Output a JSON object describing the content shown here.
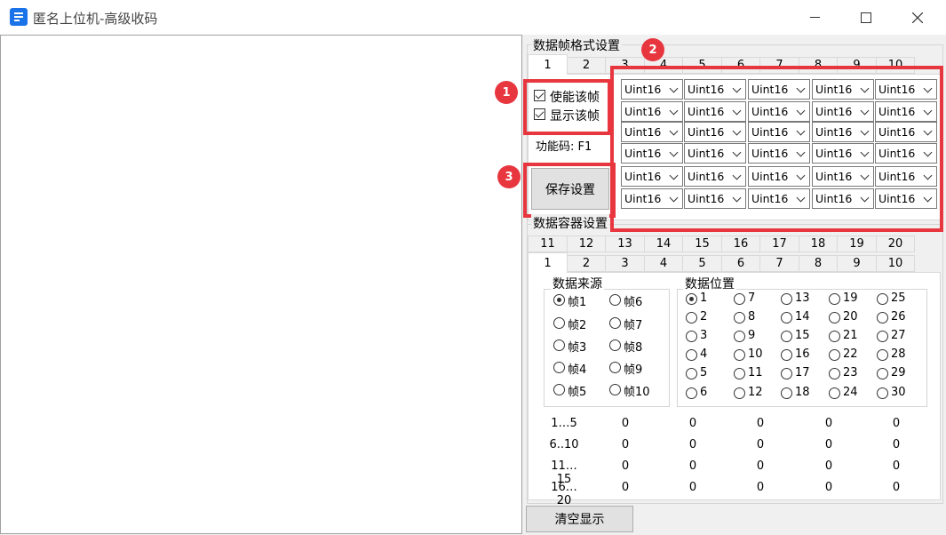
{
  "window": {
    "title": "匿名上位机-高级收码",
    "controls": [
      "minimize-icon",
      "maximize-icon",
      "close-icon"
    ]
  },
  "frame_format": {
    "group_title": "数据帧格式设置",
    "tabs": [
      "1",
      "2",
      "3",
      "4",
      "5",
      "6",
      "7",
      "8",
      "9",
      "10"
    ],
    "active_tab": "1",
    "enable_label": "使能该帧",
    "show_label": "显示该帧",
    "function_code_label": "功能码: F1",
    "save_button": "保存设置",
    "type_options_selected": [
      [
        "Uint16",
        "Uint16",
        "Uint16",
        "Uint16",
        "Uint16"
      ],
      [
        "Uint16",
        "Uint16",
        "Uint16",
        "Uint16",
        "Uint16"
      ],
      [
        "Uint16",
        "Uint16",
        "Uint16",
        "Uint16",
        "Uint16"
      ],
      [
        "Uint16",
        "Uint16",
        "Uint16",
        "Uint16",
        "Uint16"
      ],
      [
        "Uint16",
        "Uint16",
        "Uint16",
        "Uint16",
        "Uint16"
      ],
      [
        "Uint16",
        "Uint16",
        "Uint16",
        "Uint16",
        "Uint16"
      ]
    ]
  },
  "container": {
    "group_title": "数据容器设置",
    "tabs_row1": [
      "11",
      "12",
      "13",
      "14",
      "15",
      "16",
      "17",
      "18",
      "19",
      "20"
    ],
    "tabs_row2": [
      "1",
      "2",
      "3",
      "4",
      "5",
      "6",
      "7",
      "8",
      "9",
      "10"
    ],
    "active_tab": "1",
    "source_title": "数据来源",
    "sources": [
      "帧1",
      "帧2",
      "帧3",
      "帧4",
      "帧5",
      "帧6",
      "帧7",
      "帧8",
      "帧9",
      "帧10"
    ],
    "source_selected": "帧1",
    "position_title": "数据位置",
    "positions": [
      "1",
      "2",
      "3",
      "4",
      "5",
      "6",
      "7",
      "8",
      "9",
      "10",
      "11",
      "12",
      "13",
      "14",
      "15",
      "16",
      "17",
      "18",
      "19",
      "20",
      "21",
      "22",
      "23",
      "24",
      "25",
      "26",
      "27",
      "28",
      "29",
      "30"
    ],
    "position_selected": "1"
  },
  "values_table": {
    "row_labels": [
      "1…5",
      "6..10",
      "11…15",
      "16…20"
    ],
    "rows": [
      [
        "0",
        "0",
        "0",
        "0",
        "0"
      ],
      [
        "0",
        "0",
        "0",
        "0",
        "0"
      ],
      [
        "0",
        "0",
        "0",
        "0",
        "0"
      ],
      [
        "0",
        "0",
        "0",
        "0",
        "0"
      ]
    ]
  },
  "clear_button": "清空显示",
  "annotations": {
    "badges": [
      "1",
      "2",
      "3"
    ],
    "color": "#e8363f"
  }
}
